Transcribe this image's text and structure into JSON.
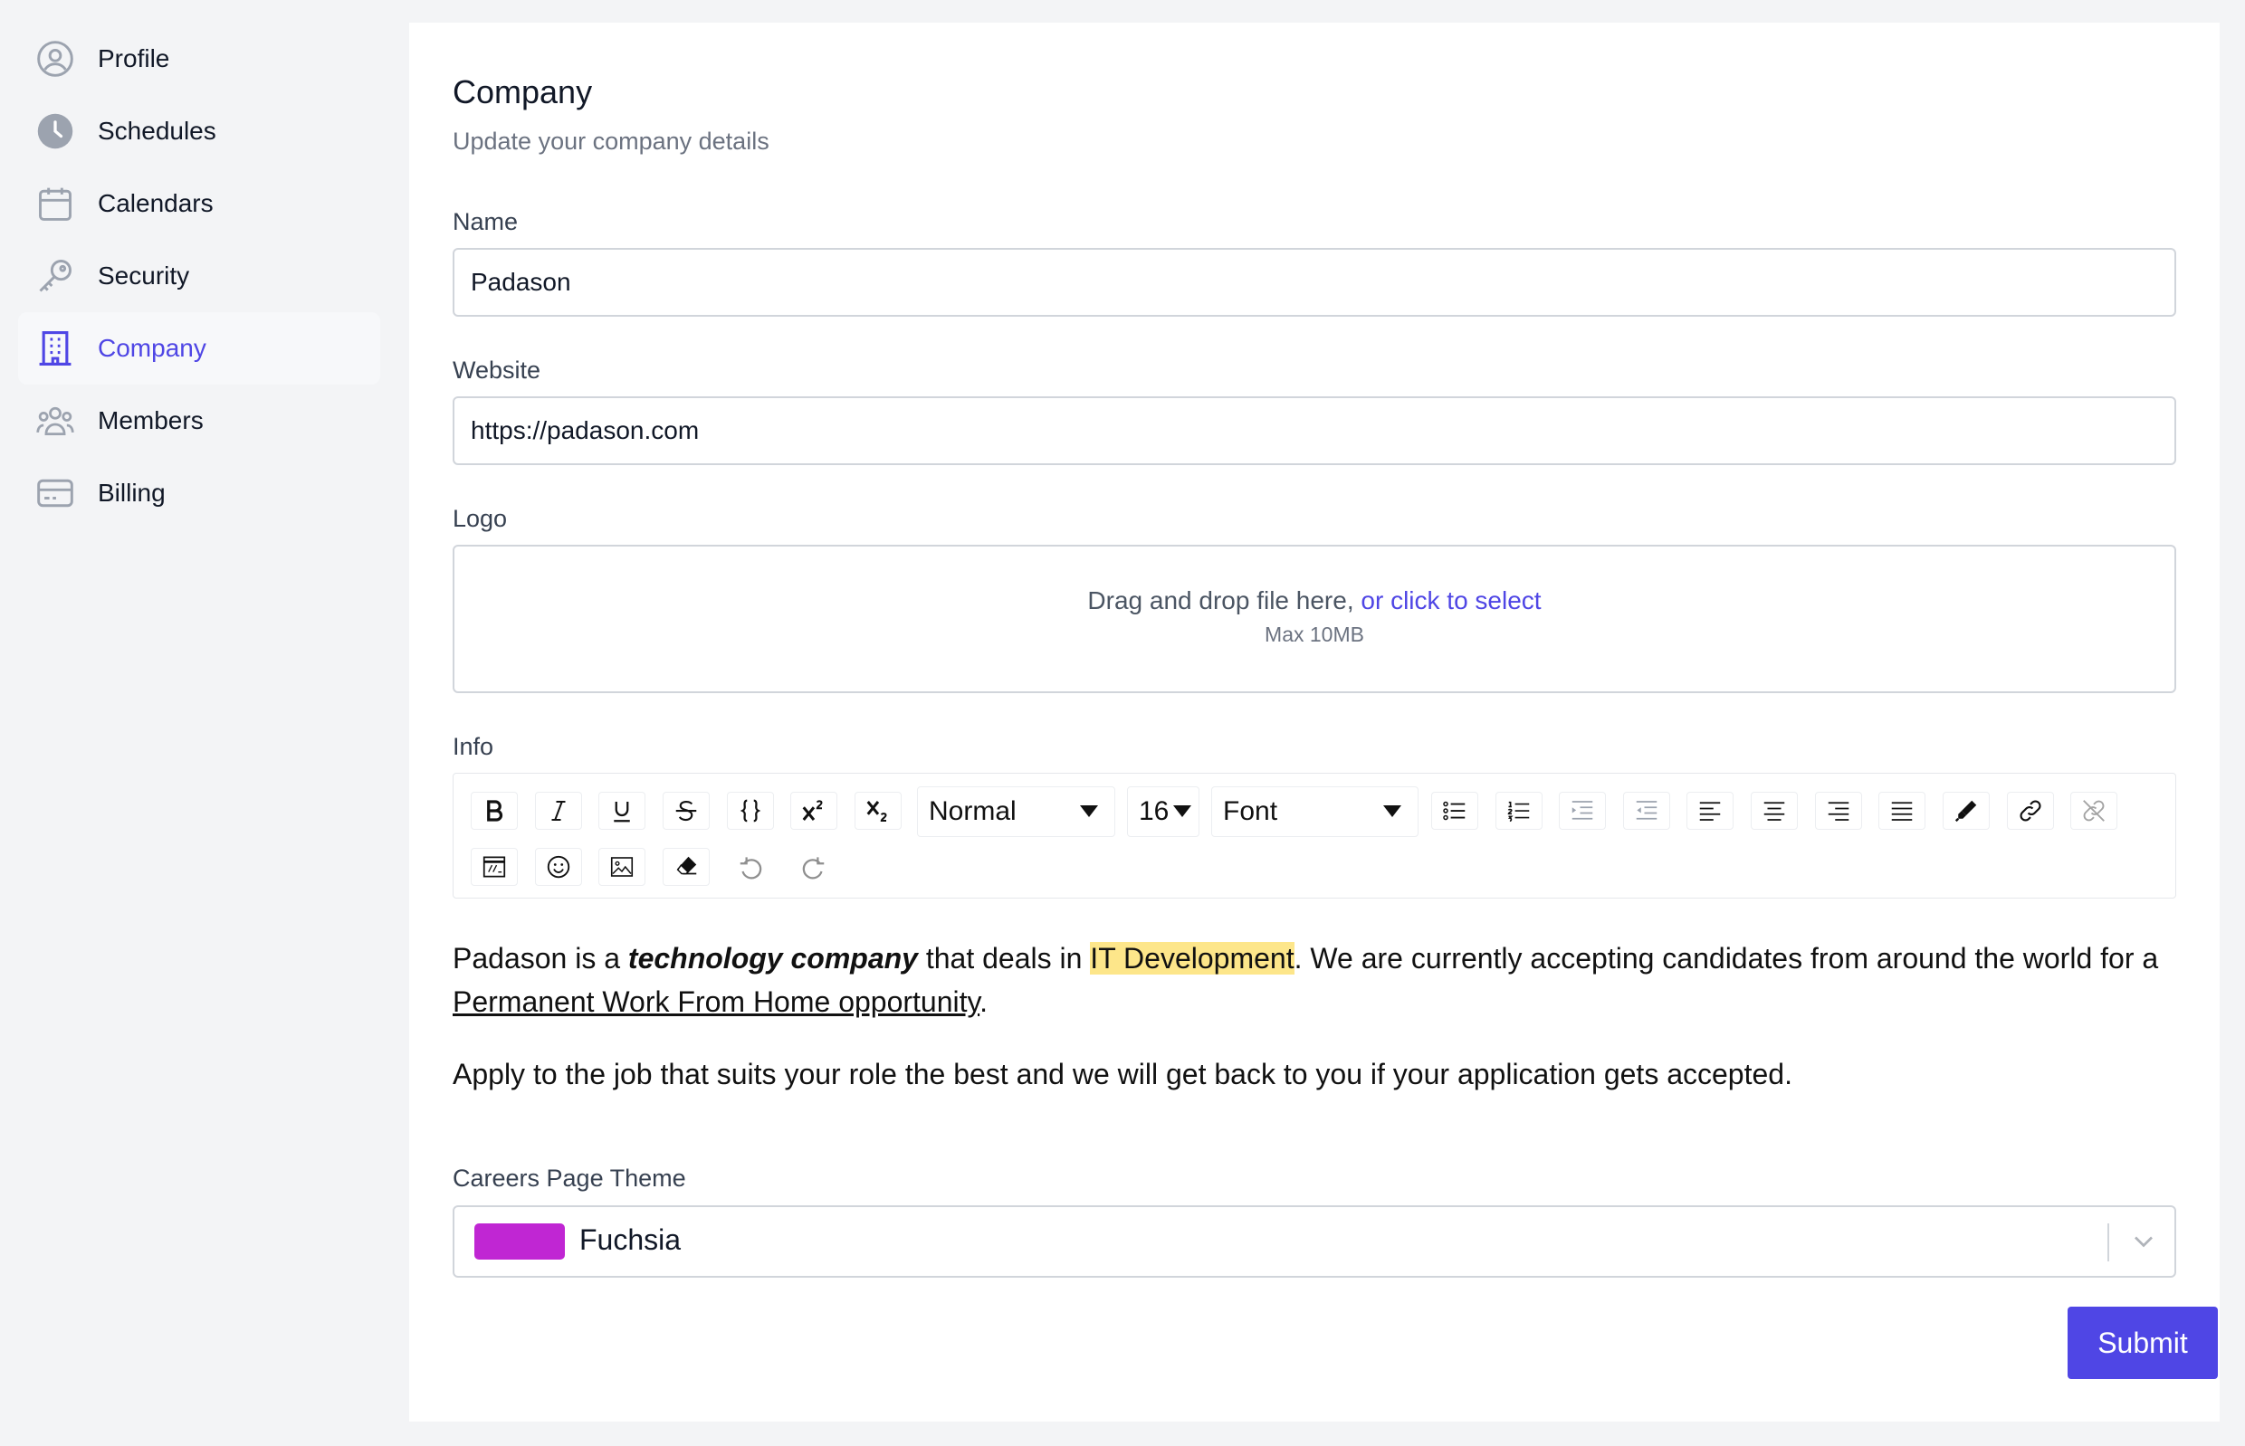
{
  "sidebar": {
    "items": [
      {
        "label": "Profile",
        "icon": "user-circle-icon"
      },
      {
        "label": "Schedules",
        "icon": "clock-icon"
      },
      {
        "label": "Calendars",
        "icon": "calendar-icon"
      },
      {
        "label": "Security",
        "icon": "key-icon"
      },
      {
        "label": "Company",
        "icon": "building-icon",
        "active": true
      },
      {
        "label": "Members",
        "icon": "users-icon"
      },
      {
        "label": "Billing",
        "icon": "credit-card-icon"
      }
    ]
  },
  "header": {
    "title": "Company",
    "subtitle": "Update your company details"
  },
  "form": {
    "name_label": "Name",
    "name_value": "Padason",
    "website_label": "Website",
    "website_value": "https://padason.com",
    "logo_label": "Logo",
    "dropzone_text": "Drag and drop file here,",
    "dropzone_link": "or click to select",
    "dropzone_hint": "Max 10MB",
    "info_label": "Info",
    "theme_label": "Careers Page Theme",
    "theme_value": "Fuchsia",
    "theme_color": "#c026d3",
    "submit_label": "Submit"
  },
  "toolbar": {
    "format_value": "Normal",
    "size_value": "16",
    "font_value": "Font"
  },
  "editor": {
    "p1_a": "Padason is a ",
    "p1_bold": "technology company",
    "p1_b": " that deals in ",
    "p1_highlight": "IT Development",
    "p1_c": ". We are currently accepting candidates from around the world for a ",
    "p1_link": "Permanent Work From Home opportunity",
    "p1_d": ".",
    "p2": "Apply to the job that suits your role the best and we will get back to you if your application gets accepted."
  },
  "colors": {
    "accent": "#4f46e5",
    "highlight": "#fde68a"
  }
}
